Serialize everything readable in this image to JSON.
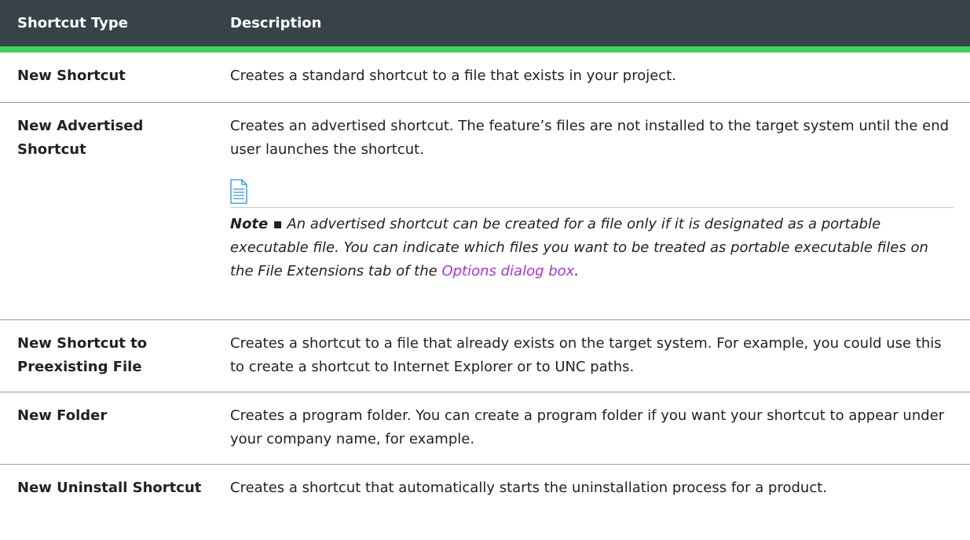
{
  "table": {
    "headers": {
      "type": "Shortcut Type",
      "description": "Description"
    },
    "rows": [
      {
        "type": "New Shortcut",
        "description": "Creates a standard shortcut to a file that exists in your project."
      },
      {
        "type": "New Advertised Shortcut",
        "description": "Creates an advertised shortcut. The feature’s files are not installed to the target system until the end user launches the shortcut.",
        "note": {
          "icon": "document-note-icon",
          "label": "Note ▪",
          "text_before": " An advertised shortcut can be created for a file only if it is designated as a portable executable file. You can indicate which files you want to be treated as portable executable files on the File Extensions tab of the ",
          "link": "Options dialog box",
          "text_after": "."
        }
      },
      {
        "type": "New Shortcut to Preexisting File",
        "description": "Creates a shortcut to a file that already exists on the target system. For example, you could use this to create a shortcut to Internet Explorer or to UNC paths."
      },
      {
        "type": "New Folder",
        "description": "Creates a program folder. You can create a program folder if you want your shortcut to appear under your company name, for example."
      },
      {
        "type": "New Uninstall Shortcut",
        "description": "Creates a shortcut that automatically starts the uninstallation process for a product."
      }
    ]
  },
  "colors": {
    "header_bg": "#374249",
    "header_accent": "#3ad35b",
    "link": "#a535e0"
  }
}
